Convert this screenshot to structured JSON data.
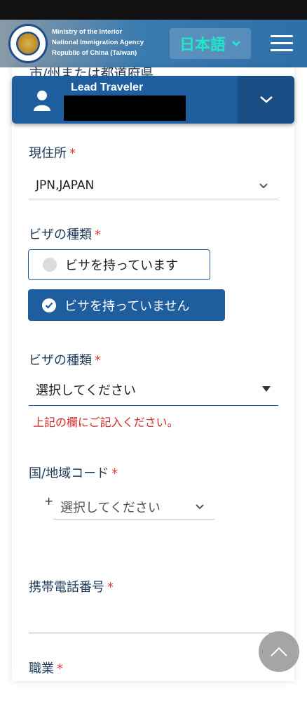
{
  "header": {
    "agency_lines": [
      "Ministry of the Interior",
      "National Immigration Agency",
      "Republic of China (Taiwan)"
    ],
    "language_label": "日本語",
    "language_color": "#21e6c8"
  },
  "partial_text": "市/州または都道府県",
  "traveler": {
    "label": "Lead Traveler"
  },
  "form": {
    "residence": {
      "label": "現住所",
      "required_mark": "*",
      "value": "JPN,JAPAN"
    },
    "visa_type_1": {
      "label": "ビザの種類",
      "required_mark": "*",
      "options": [
        "ビサを持っています",
        "ビサを持っていません"
      ],
      "selected_index": 1
    },
    "visa_type_2": {
      "label": "ビザの種類",
      "required_mark": "*",
      "placeholder": "選択してください",
      "error": "上記の欄にご記入ください。"
    },
    "country_code": {
      "label": "国/地域コード",
      "required_mark": "*",
      "prefix": "+",
      "placeholder": "選択してください"
    },
    "mobile": {
      "label": "携帯電話番号",
      "required_mark": "*",
      "value": ""
    },
    "occupation": {
      "label": "職業",
      "required_mark": "*"
    }
  },
  "colors": {
    "primary": "#1e5d9e",
    "error": "#d42a2a",
    "required": "#e03c3c"
  }
}
